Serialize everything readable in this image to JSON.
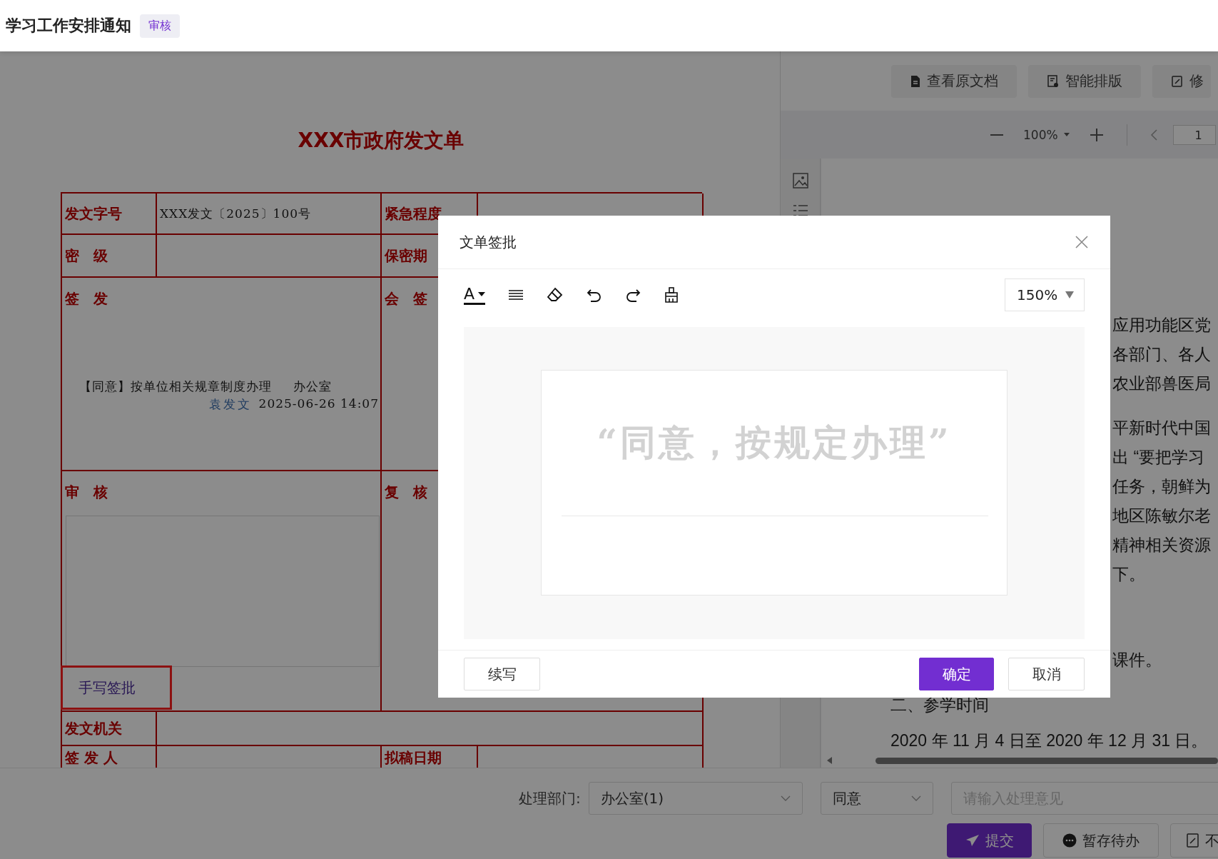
{
  "header": {
    "title": "学习工作安排通知",
    "badge": "审核"
  },
  "document": {
    "title": "XXX市政府发文单",
    "rows": [
      {
        "kind": "pair",
        "label": "发文字号",
        "value": "XXX发文〔2025〕100号",
        "label_2": "紧急程度"
      },
      {
        "kind": "pair",
        "label": "密　级",
        "label_2": "保密期"
      },
      {
        "kind": "opinion",
        "label": "签　发",
        "opinion": "【同意】按单位相关规章制度办理",
        "dept": "办公室",
        "signer": "袁发文",
        "time": "2025-06-26 14:07",
        "label_2": "会　签"
      },
      {
        "kind": "handwrite",
        "label": "审　核",
        "action": "手写签批",
        "label_2": "复　核"
      },
      {
        "kind": "full",
        "label": "发文机关"
      },
      {
        "kind": "pair",
        "label": "签 发 人",
        "label_2": "拟稿日期"
      }
    ]
  },
  "viewer": {
    "buttons": [
      {
        "kind": "doc",
        "label": "查看原文档"
      },
      {
        "kind": "layout",
        "label": "智能排版"
      },
      {
        "kind": "edit",
        "label": "修"
      }
    ],
    "zoom": "100%",
    "page": "1",
    "paragraphs": [
      {
        "kind": "fragment",
        "lines": [
          "应用功能区党",
          "各部门、各人",
          "农业部兽医局"
        ]
      },
      {
        "kind": "fragment",
        "lines": [
          "平新时代中国",
          "出 “要把学习",
          "任务，朝鲜为",
          "地区陈敏尔老",
          "精神相关资源",
          "下。"
        ]
      },
      {
        "kind": "fragment",
        "lines": [
          "课件。"
        ]
      },
      {
        "kind": "body",
        "lines": [
          "二、参学时间"
        ]
      },
      {
        "kind": "body",
        "lines": [
          "2020 年 11 月 4 日至 2020 年 12 月 31 日。"
        ]
      }
    ]
  },
  "bottom_bar": {
    "dept_label": "处理部门:",
    "dept": "办公室(1)",
    "decision": "同意",
    "opinion_placeholder": "请输入处理意见",
    "buttons": [
      {
        "kind": "submit",
        "label": "提交"
      },
      {
        "kind": "save",
        "label": "暂存待办"
      },
      {
        "kind": "other",
        "label": "不"
      }
    ]
  },
  "dialog": {
    "title": "文单签批",
    "tools": [
      {
        "kind": "color",
        "label": "A"
      },
      {
        "kind": "lines"
      },
      {
        "kind": "eraser"
      },
      {
        "kind": "undo"
      },
      {
        "kind": "redo"
      },
      {
        "kind": "clear"
      }
    ],
    "zoom": "150%",
    "signature": "“同意，按规定办理”",
    "continue_button": "续写",
    "confirm_button": "确定",
    "cancel_button": "取消"
  }
}
